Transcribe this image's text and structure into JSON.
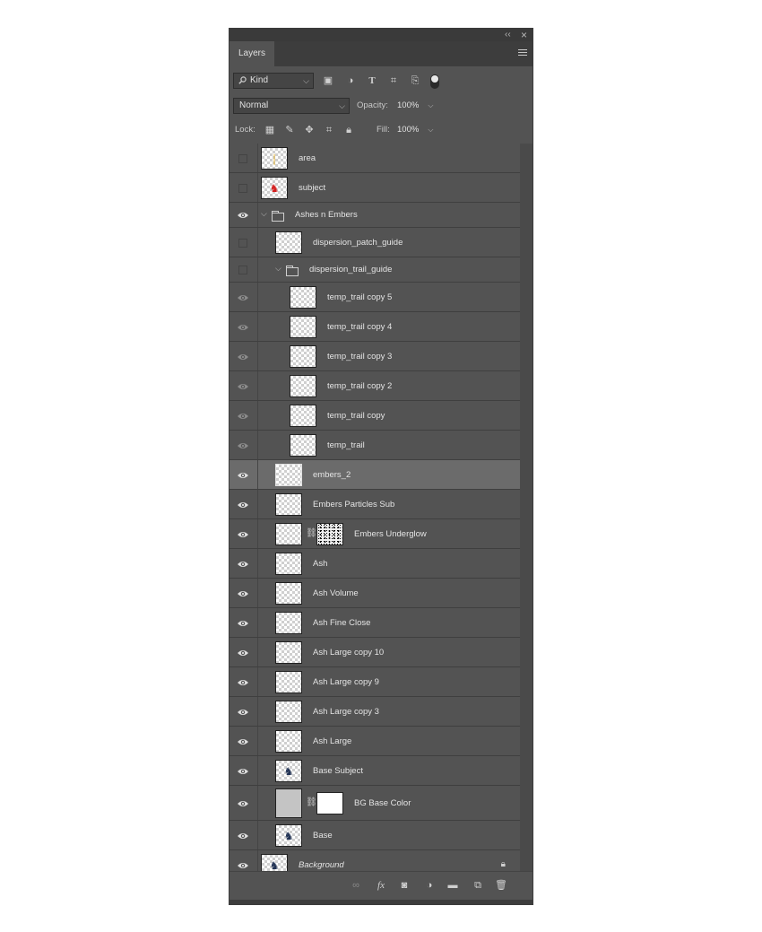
{
  "window": {
    "collapse_label": "‹‹",
    "close_label": "×"
  },
  "tabs": {
    "layers": "Layers"
  },
  "filter": {
    "kind_label": "Kind"
  },
  "blend": {
    "mode": "Normal",
    "opacity_label": "Opacity:",
    "opacity_value": "100%"
  },
  "lock": {
    "label": "Lock:",
    "fill_label": "Fill:",
    "fill_value": "100%"
  },
  "layers": [
    {
      "name": "area",
      "level": 0,
      "visible": false,
      "thumb": "area"
    },
    {
      "name": "subject",
      "level": 0,
      "visible": false,
      "thumb": "subject"
    },
    {
      "name": "Ashes n Embers",
      "level": 0,
      "visible": true,
      "group": true,
      "expanded": true
    },
    {
      "name": "dispersion_patch_guide",
      "level": 1,
      "visible": false,
      "thumb": "transparent"
    },
    {
      "name": "dispersion_trail_guide",
      "level": 1,
      "visible": false,
      "group": true,
      "expanded": true
    },
    {
      "name": "temp_trail copy 5",
      "level": 2,
      "visible": "dim",
      "thumb": "transparent"
    },
    {
      "name": "temp_trail copy 4",
      "level": 2,
      "visible": "dim",
      "thumb": "transparent"
    },
    {
      "name": "temp_trail copy 3",
      "level": 2,
      "visible": "dim",
      "thumb": "transparent"
    },
    {
      "name": "temp_trail copy 2",
      "level": 2,
      "visible": "dim",
      "thumb": "transparent"
    },
    {
      "name": "temp_trail copy",
      "level": 2,
      "visible": "dim",
      "thumb": "transparent"
    },
    {
      "name": "temp_trail",
      "level": 2,
      "visible": "dim",
      "thumb": "transparent"
    },
    {
      "name": "embers_2",
      "level": 1,
      "visible": true,
      "thumb": "transparent",
      "selected": true
    },
    {
      "name": "Embers Particles Sub",
      "level": 1,
      "visible": true,
      "thumb": "transparent"
    },
    {
      "name": "Embers Underglow",
      "level": 1,
      "visible": true,
      "thumb": "transparent",
      "mask": "noise"
    },
    {
      "name": "Ash",
      "level": 1,
      "visible": true,
      "thumb": "transparent"
    },
    {
      "name": "Ash Volume",
      "level": 1,
      "visible": true,
      "thumb": "transparent"
    },
    {
      "name": "Ash Fine Close",
      "level": 1,
      "visible": true,
      "thumb": "transparent"
    },
    {
      "name": "Ash Large copy 10",
      "level": 1,
      "visible": true,
      "thumb": "transparent"
    },
    {
      "name": "Ash Large copy 9",
      "level": 1,
      "visible": true,
      "thumb": "transparent"
    },
    {
      "name": "Ash Large copy 3",
      "level": 1,
      "visible": true,
      "thumb": "transparent"
    },
    {
      "name": "Ash Large",
      "level": 1,
      "visible": true,
      "thumb": "transparent"
    },
    {
      "name": "Base Subject",
      "level": 1,
      "visible": true,
      "thumb": "figure"
    },
    {
      "name": "BG Base Color",
      "level": 1,
      "visible": true,
      "thumb": "gray",
      "mask": "white",
      "tall": true
    },
    {
      "name": "Base",
      "level": 1,
      "visible": true,
      "thumb": "figure"
    },
    {
      "name": "Background",
      "level": 0,
      "visible": true,
      "thumb": "figure",
      "italic": true,
      "locked": true
    }
  ],
  "colors": {
    "panel": "#535353",
    "selected_row": "#6b6b6b",
    "area_mark": "#e6b63a",
    "subject_mark": "#d42020"
  }
}
